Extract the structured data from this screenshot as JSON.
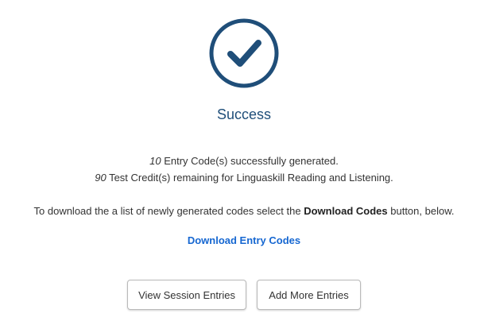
{
  "success": {
    "icon": "check-circle-icon",
    "title": "Success",
    "accent_color": "#1f4e79"
  },
  "message": {
    "entry_count": "10",
    "entry_text": " Entry Code(s) successfully generated.",
    "credit_count": "90",
    "credit_text": " Test Credit(s) remaining for Linguaskill Reading and Listening.",
    "download_prefix": "To download the a list of newly generated codes select the ",
    "download_button_name": "Download Codes",
    "download_suffix": " button, below."
  },
  "download_link": {
    "label": "Download Entry Codes",
    "color": "#1667d1"
  },
  "actions": {
    "view_session_entries": "View Session Entries",
    "add_more_entries": "Add More Entries"
  }
}
